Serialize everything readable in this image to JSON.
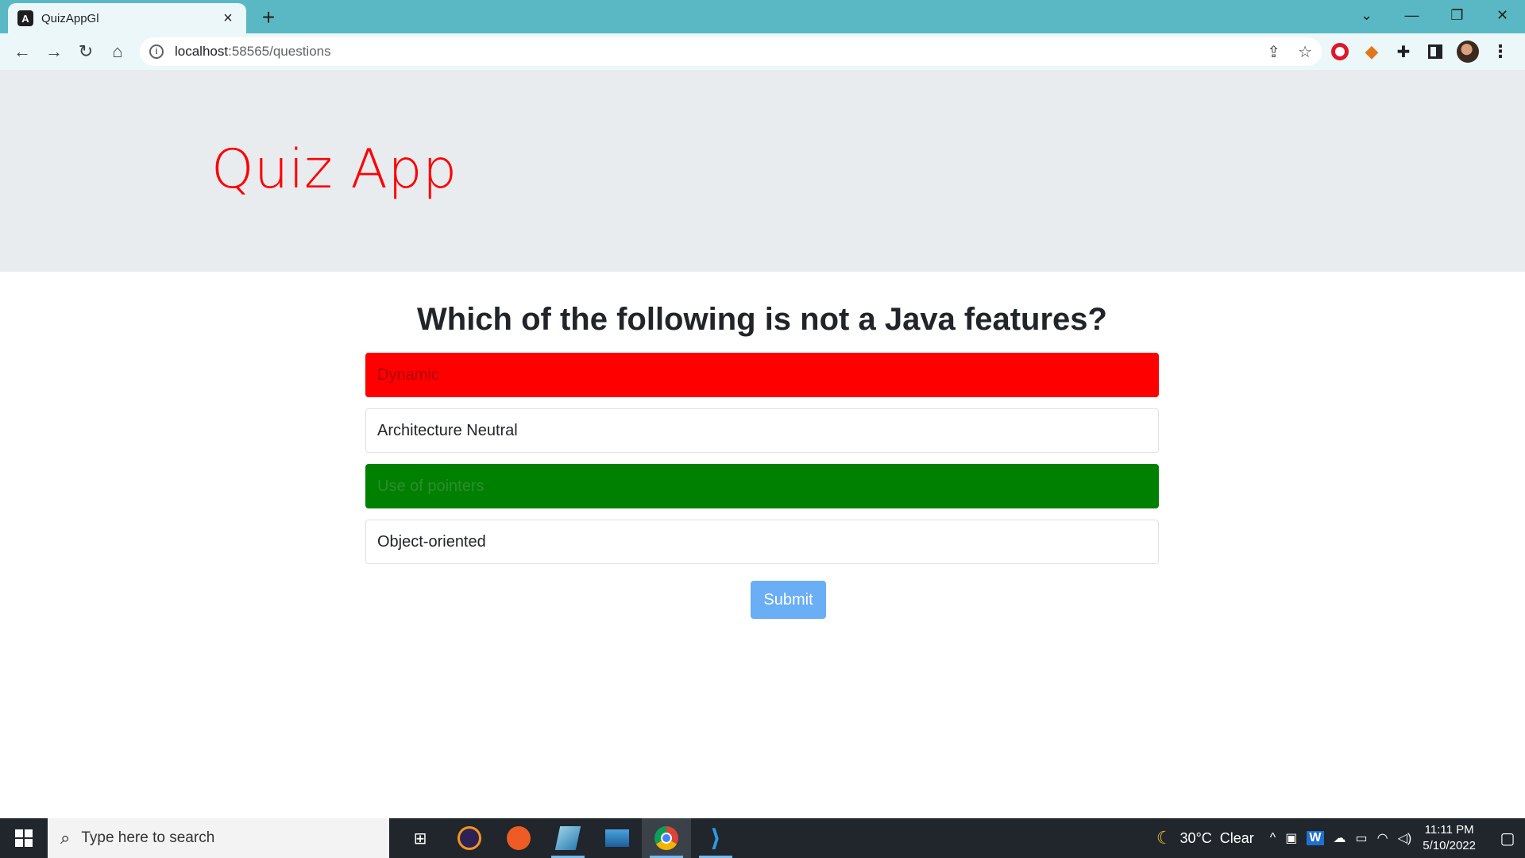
{
  "browser": {
    "tab_title": "QuizAppGl",
    "tab_favicon": "A",
    "new_tab_symbol": "+",
    "url_host": "localhost",
    "url_path": ":58565/questions",
    "icons": [
      "back-icon",
      "forward-icon",
      "reload-icon",
      "home-icon",
      "info-icon",
      "share-icon",
      "star-icon",
      "opera-icon",
      "metamask-icon",
      "extensions-icon",
      "side-panel-icon",
      "avatar",
      "menu-icon"
    ]
  },
  "app": {
    "title": "Quiz App",
    "title_color": "#ff0000"
  },
  "quiz": {
    "question": "Which of the following is not a Java features?",
    "options": [
      {
        "label": "Dynamic",
        "state": "wrong",
        "color": "#ff0000"
      },
      {
        "label": "Architecture Neutral",
        "state": "none"
      },
      {
        "label": "Use of pointers",
        "state": "correct",
        "color": "#008000"
      },
      {
        "label": "Object-oriented",
        "state": "none"
      }
    ],
    "submit_label": "Submit"
  },
  "taskbar": {
    "search_placeholder": "Type here to search",
    "weather": "30°C  Clear",
    "time": "11:11 PM",
    "date": "5/10/2022",
    "apps": [
      "task-view-icon",
      "eclipse-icon",
      "postman-icon",
      "notes-icon",
      "laptop-icon",
      "chrome-icon",
      "vscode-icon"
    ]
  }
}
